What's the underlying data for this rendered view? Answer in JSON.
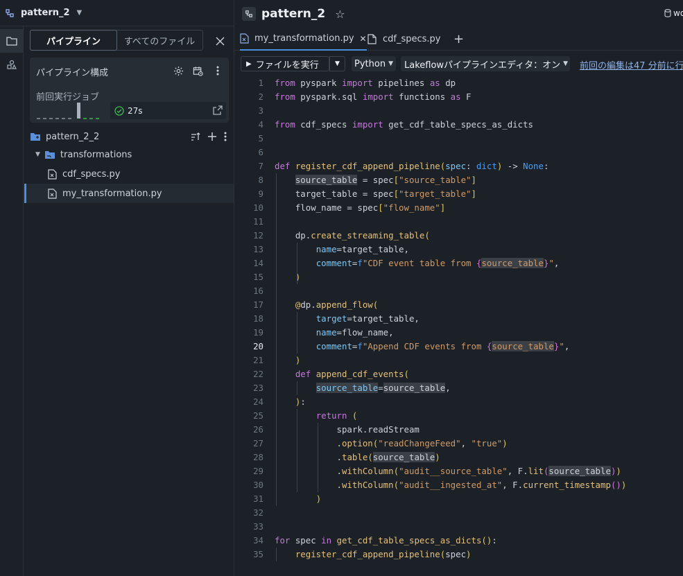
{
  "app": {
    "pipeline_name": "pattern_2"
  },
  "left_panel": {
    "tabs": [
      "パイプライン",
      "すべてのファイル"
    ],
    "config_title": "パイプライン構成",
    "last_run_label": "前回実行ジョブ",
    "last_run_duration": "27s",
    "last_run_status": "success"
  },
  "tree": {
    "root": "pattern_2_2",
    "folder": "transformations",
    "files": [
      "cdf_specs.py",
      "my_transformation.py"
    ],
    "selected": "my_transformation.py"
  },
  "header": {
    "title": "pattern_2",
    "workspace_label": "wo"
  },
  "editor_tabs": [
    {
      "label": "my_transformation.py",
      "active": true
    },
    {
      "label": "cdf_specs.py",
      "active": false
    }
  ],
  "toolbar": {
    "run_label": "ファイルを実行",
    "language": "Python",
    "editor_toggle": "Lakeflowパイプラインエディタ：オン",
    "last_edit": "前回の編集は47 分前に行"
  },
  "code": {
    "current_line": 20,
    "lines": [
      "from pyspark import pipelines as dp",
      "from pyspark.sql import functions as F",
      "",
      "from cdf_specs import get_cdf_table_specs_as_dicts",
      "",
      "",
      "def register_cdf_append_pipeline(spec: dict) -> None:",
      "    source_table = spec[\"source_table\"]",
      "    target_table = spec[\"target_table\"]",
      "    flow_name = spec[\"flow_name\"]",
      "",
      "    dp.create_streaming_table(",
      "        name=target_table,",
      "        comment=f\"CDF event table from {source_table}\",",
      "    )",
      "",
      "    @dp.append_flow(",
      "        target=target_table,",
      "        name=flow_name,",
      "        comment=f\"Append CDF events from {source_table}\",",
      "    )",
      "    def append_cdf_events(",
      "        source_table=source_table,",
      "    ):",
      "        return (",
      "            spark.readStream",
      "            .option(\"readChangeFeed\", \"true\")",
      "            .table(source_table)",
      "            .withColumn(\"audit__source_table\", F.lit(source_table))",
      "            .withColumn(\"audit__ingested_at\", F.current_timestamp())",
      "        )",
      "",
      "",
      "for spec in get_cdf_table_specs_as_dicts():",
      "    register_cdf_append_pipeline(spec)"
    ]
  },
  "colors": {
    "accent": "#4b8fe2",
    "keyword": "#c678dd",
    "string": "#d19a66",
    "function": "#e5c07b",
    "builtin": "#4d9cf0",
    "success": "#3fb950"
  }
}
